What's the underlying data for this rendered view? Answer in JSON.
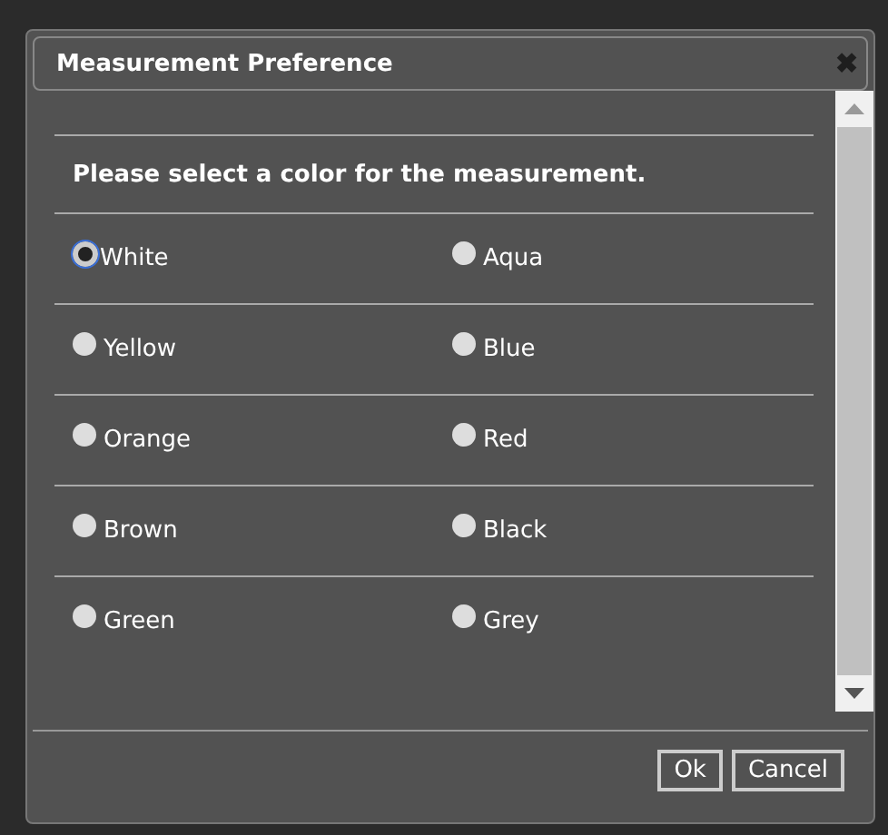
{
  "dialog": {
    "title": "Measurement Preference",
    "close": "✖",
    "prompt": "Please select a color for the measurement.",
    "options": [
      {
        "label": "White",
        "selected": true
      },
      {
        "label": "Aqua",
        "selected": false
      },
      {
        "label": "Yellow",
        "selected": false
      },
      {
        "label": "Blue",
        "selected": false
      },
      {
        "label": "Orange",
        "selected": false
      },
      {
        "label": "Red",
        "selected": false
      },
      {
        "label": "Brown",
        "selected": false
      },
      {
        "label": "Black",
        "selected": false
      },
      {
        "label": "Green",
        "selected": false
      },
      {
        "label": "Grey",
        "selected": false
      }
    ],
    "buttons": [
      "Ok",
      "Cancel"
    ]
  }
}
